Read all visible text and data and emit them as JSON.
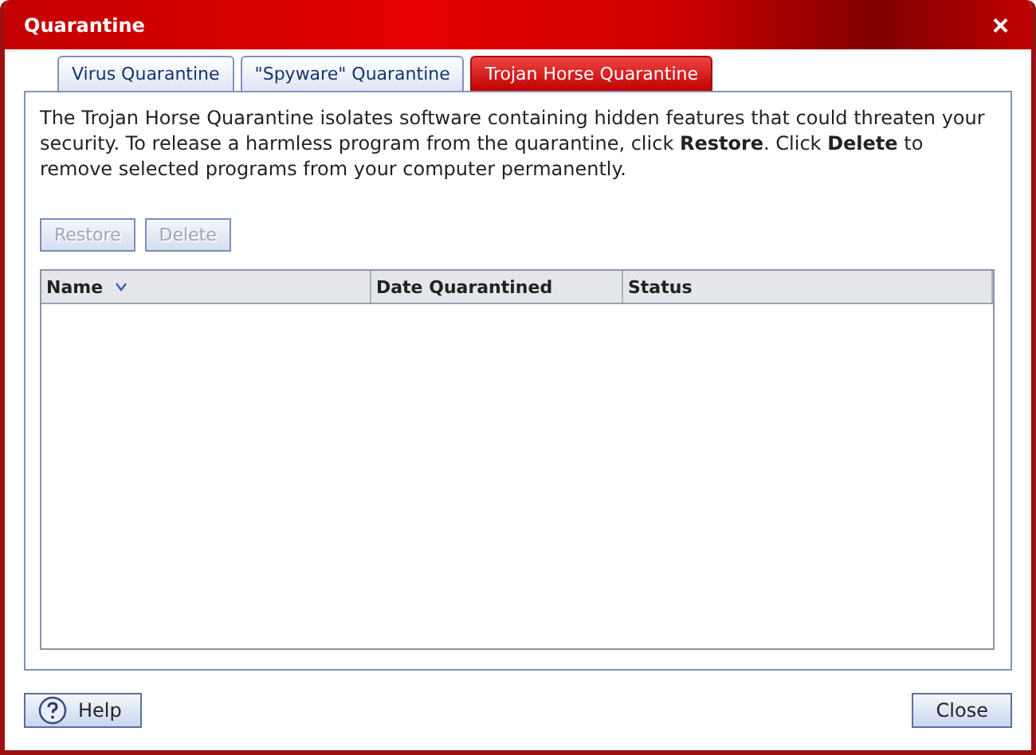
{
  "window": {
    "title": "Quarantine",
    "close": "×"
  },
  "tabs": [
    {
      "label": "Virus Quarantine",
      "selected": false
    },
    {
      "label": "\"Spyware\" Quarantine",
      "selected": false
    },
    {
      "label": "Trojan Horse Quarantine",
      "selected": true
    }
  ],
  "description": "The Trojan Horse Quarantine isolates software containing hidden features that could threaten your security. To release a harmless program from the quarantine, click **Restore**. Click **Delete** to remove selected programs from your computer permanently.",
  "actions": [
    {
      "label": "Restore",
      "disabled": true
    },
    {
      "label": "Delete",
      "disabled": true
    }
  ],
  "table": {
    "columns": [
      {
        "label": "Name",
        "sorted": true
      },
      {
        "label": "Date Quarantined",
        "sorted": false
      },
      {
        "label": "Status",
        "sorted": false
      }
    ]
  },
  "footer": {
    "help": "Help",
    "close": "Close"
  }
}
